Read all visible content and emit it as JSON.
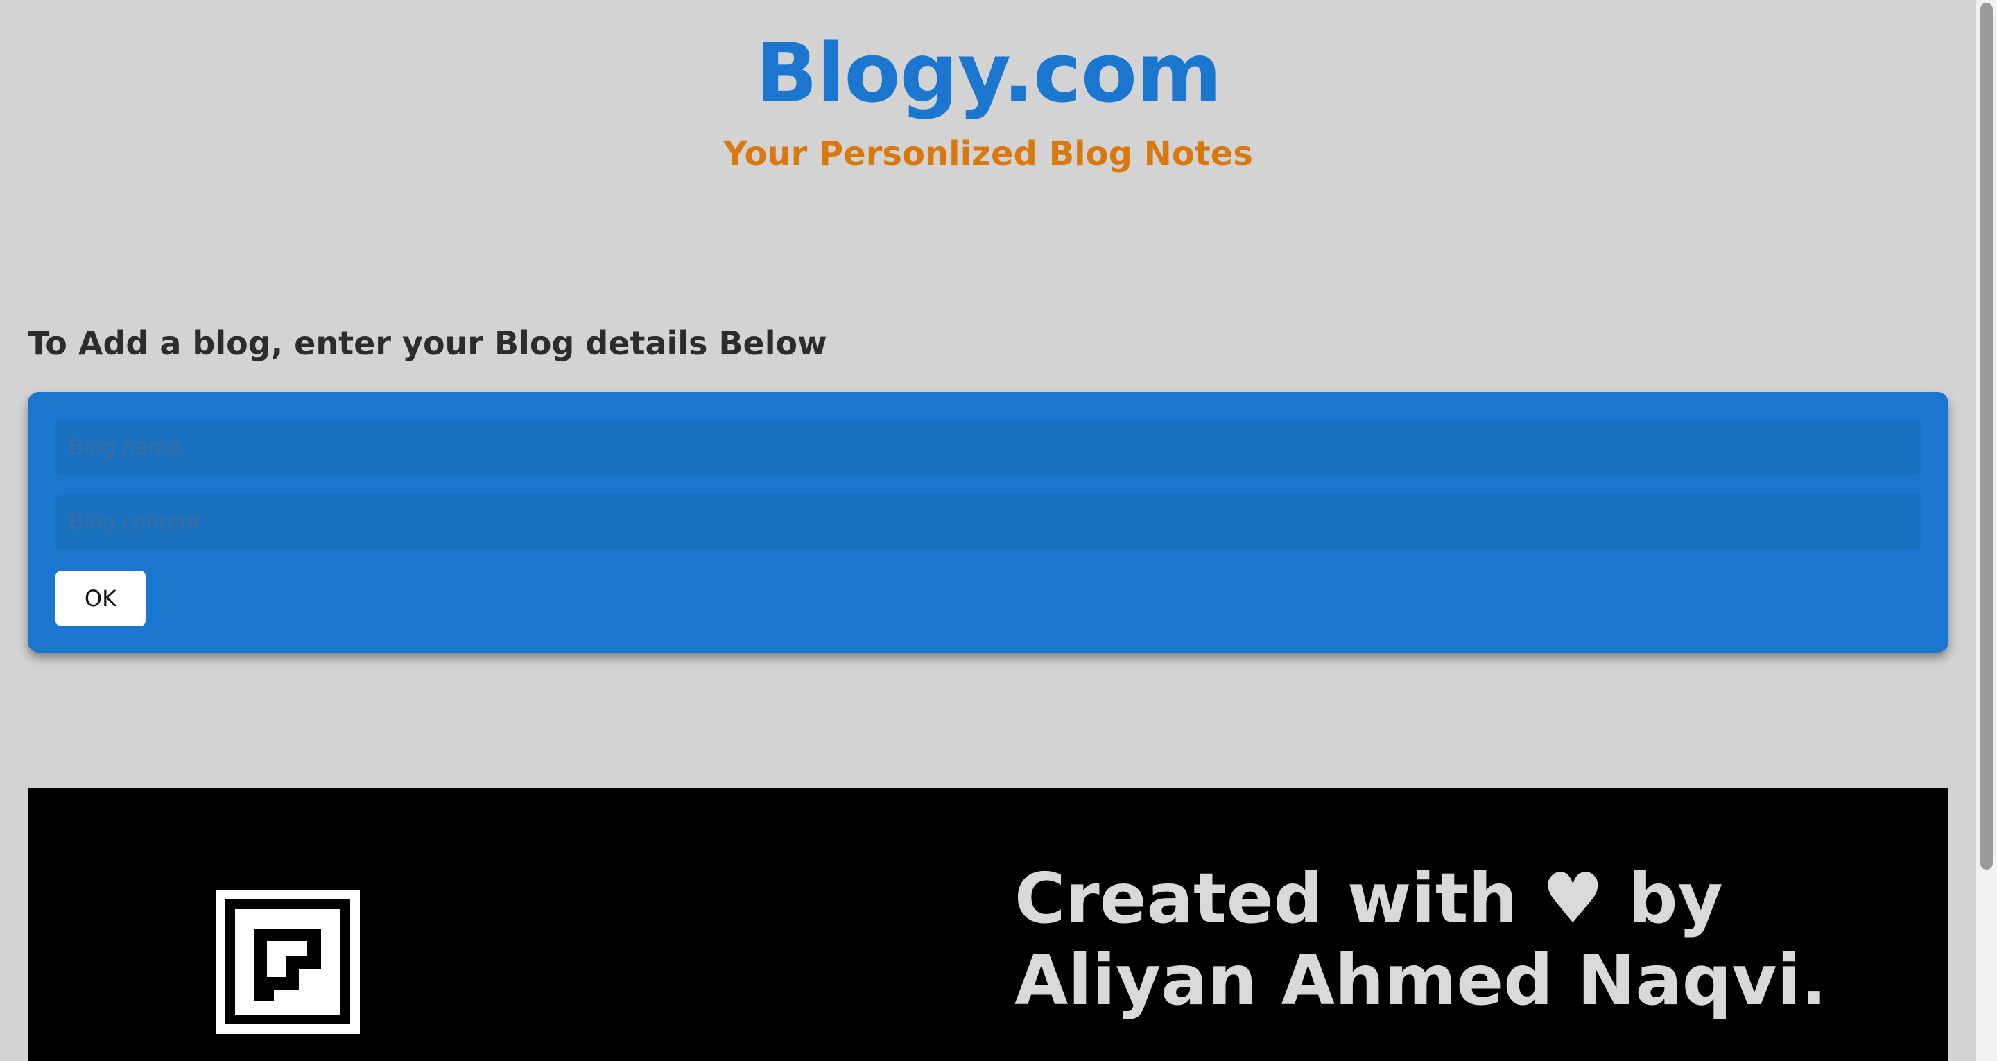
{
  "header": {
    "title": "Blogy.com",
    "subtitle": "Your Personlized Blog Notes"
  },
  "main": {
    "heading": "To Add a blog, enter your Blog details Below",
    "form": {
      "name_placeholder": "Blog name",
      "name_value": "",
      "content_placeholder": "Blog content",
      "content_value": "",
      "ok_label": "OK"
    }
  },
  "footer": {
    "logo_icon": "stairs-square-logo-icon",
    "credit_line1": "Created with ♥ by",
    "credit_line2": "Aliyan Ahmed Naqvi."
  },
  "colors": {
    "page_background": "#d3d3d3",
    "brand_blue": "#1a76cf",
    "subtitle_orange": "#d9790d",
    "footer_background": "#000000",
    "footer_text": "#d9d9d9"
  }
}
